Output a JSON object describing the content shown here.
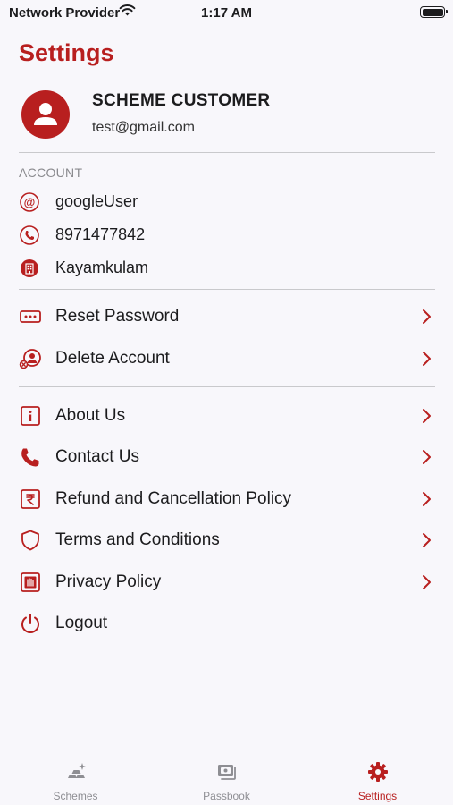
{
  "status_bar": {
    "carrier": "Network Provider",
    "time": "1:17 AM"
  },
  "page": {
    "title": "Settings"
  },
  "profile": {
    "name": "SCHEME CUSTOMER",
    "email": "test@gmail.com"
  },
  "account": {
    "section_label": "ACCOUNT",
    "items": [
      {
        "icon": "at-sign-icon",
        "value": "googleUser"
      },
      {
        "icon": "phone-icon",
        "value": "8971477842"
      },
      {
        "icon": "building-icon",
        "value": "Kayamkulam"
      }
    ]
  },
  "security_menu": [
    {
      "icon": "password-icon",
      "label": "Reset Password"
    },
    {
      "icon": "delete-user-icon",
      "label": "Delete Account"
    }
  ],
  "info_menu": [
    {
      "icon": "info-icon",
      "label": "About Us"
    },
    {
      "icon": "phone-handset-icon",
      "label": "Contact Us"
    },
    {
      "icon": "rupee-icon",
      "label": "Refund and Cancellation Policy"
    },
    {
      "icon": "shield-icon",
      "label": "Terms and Conditions"
    },
    {
      "icon": "hand-stop-icon",
      "label": "Privacy Policy"
    },
    {
      "icon": "power-icon",
      "label": "Logout"
    }
  ],
  "tab_bar": {
    "tabs": [
      {
        "icon": "gold-bars-icon",
        "label": "Schemes",
        "active": false
      },
      {
        "icon": "passbook-icon",
        "label": "Passbook",
        "active": false
      },
      {
        "icon": "gear-icon",
        "label": "Settings",
        "active": true
      }
    ]
  },
  "colors": {
    "accent": "#b81f1f",
    "background": "#f8f7fb",
    "divider": "#c9c9cc",
    "inactive": "#8e8e93"
  }
}
